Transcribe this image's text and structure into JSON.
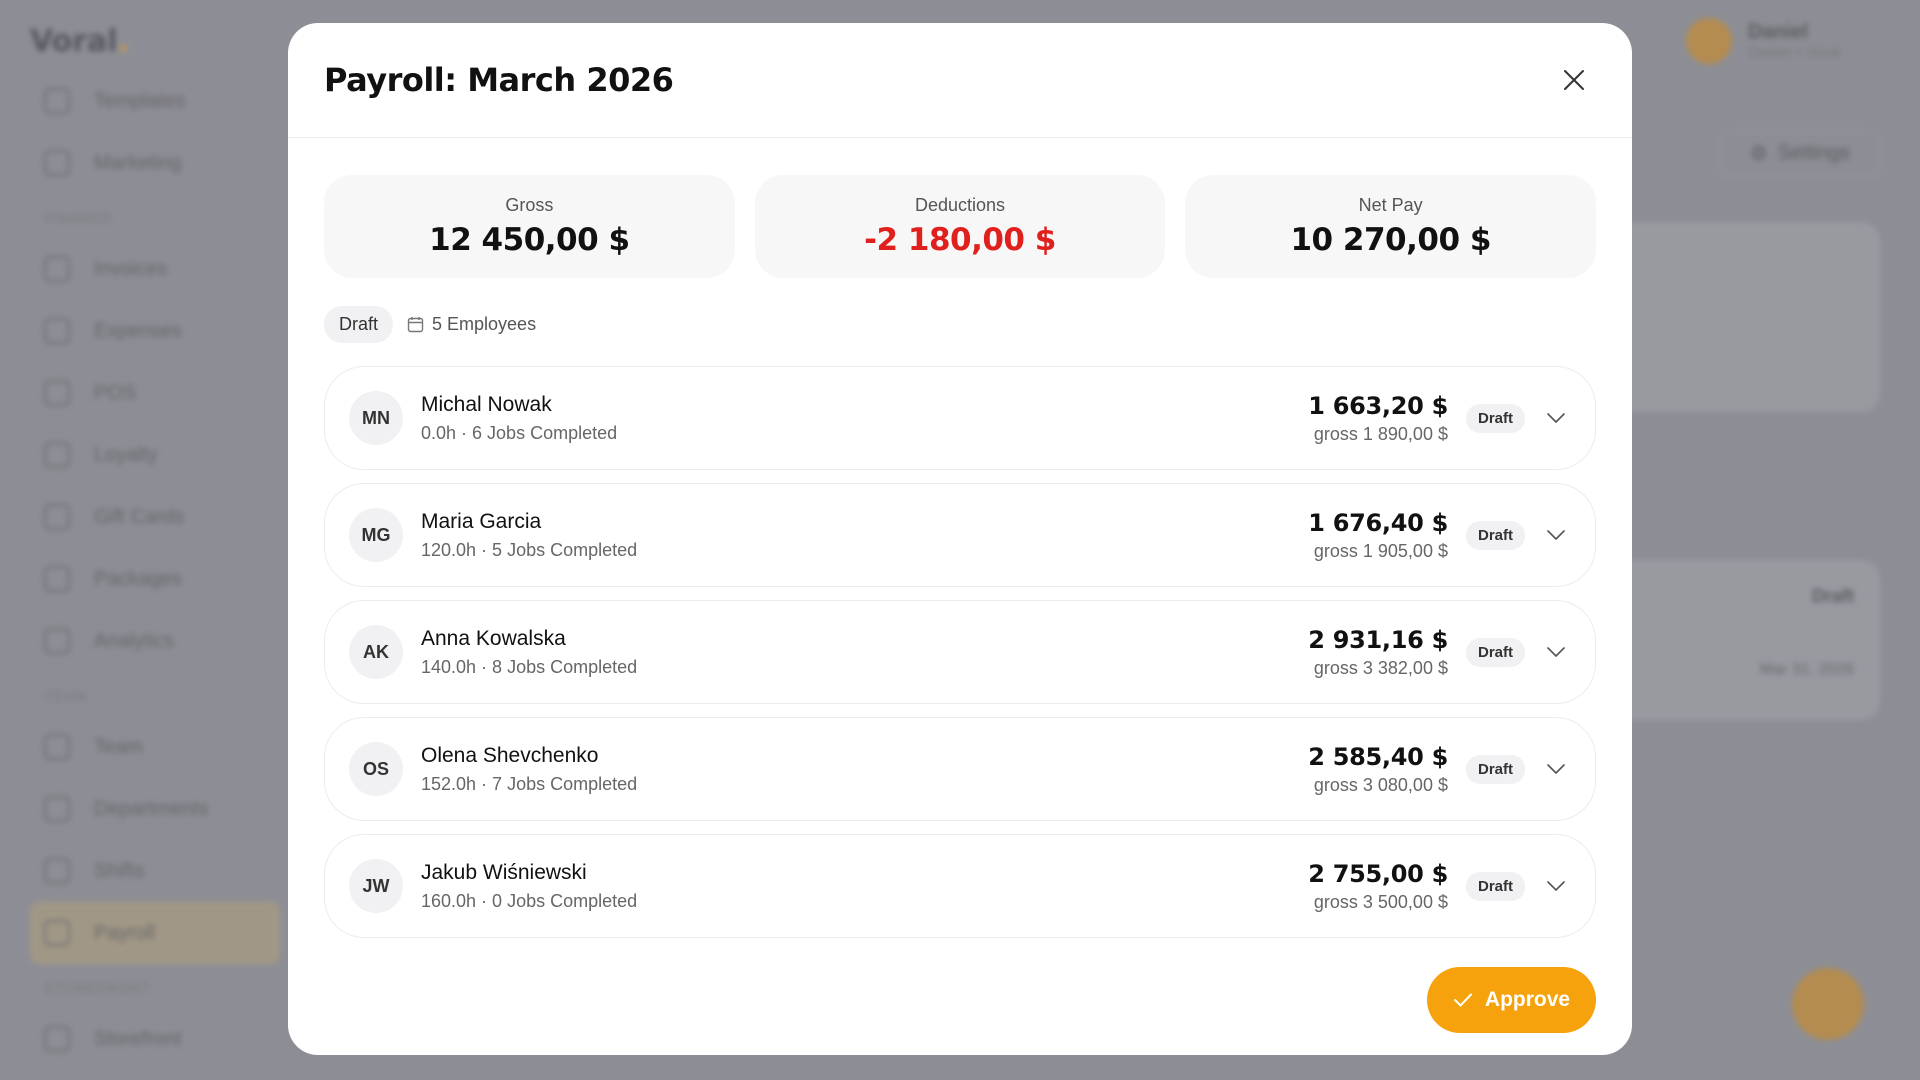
{
  "background": {
    "logo": "Voral",
    "nav": [
      {
        "label": "Templates",
        "icon": "template-icon"
      },
      {
        "label": "Marketing",
        "icon": "megaphone-icon"
      },
      {
        "section": "FINANCE"
      },
      {
        "label": "Invoices",
        "icon": "invoice-icon"
      },
      {
        "label": "Expenses",
        "icon": "receipt-icon"
      },
      {
        "label": "POS",
        "icon": "cart-icon"
      },
      {
        "label": "Loyalty",
        "icon": "heart-icon"
      },
      {
        "label": "Gift Cards",
        "icon": "gift-icon"
      },
      {
        "label": "Packages",
        "icon": "package-icon"
      },
      {
        "label": "Analytics",
        "icon": "chart-icon"
      },
      {
        "section": "TEAM"
      },
      {
        "label": "Team",
        "icon": "users-icon"
      },
      {
        "label": "Departments",
        "icon": "building-icon"
      },
      {
        "label": "Shifts",
        "icon": "clock-icon"
      },
      {
        "label": "Payroll",
        "icon": "wallet-icon",
        "active": true
      },
      {
        "section": "STOREFRONT"
      },
      {
        "label": "Storefront",
        "icon": "store-icon"
      }
    ],
    "user_name": "Daniel",
    "user_sub": "Owner • Voral",
    "settings_label": "Settings",
    "bg_badge": "Draft",
    "bg_date": "Mar 31, 2026"
  },
  "modal": {
    "title": "Payroll: March 2026",
    "summary": {
      "gross_label": "Gross",
      "gross_value": "12 450,00 $",
      "deductions_label": "Deductions",
      "deductions_value": "-2 180,00 $",
      "net_label": "Net Pay",
      "net_value": "10 270,00 $"
    },
    "status": "Draft",
    "employee_count": "5 Employees",
    "employees": [
      {
        "initials": "MN",
        "name": "Michal Nowak",
        "sub": "0.0h · 6 Jobs Completed",
        "net": "1 663,20 $",
        "gross": "gross 1 890,00 $",
        "status": "Draft"
      },
      {
        "initials": "MG",
        "name": "Maria Garcia",
        "sub": "120.0h · 5 Jobs Completed",
        "net": "1 676,40 $",
        "gross": "gross 1 905,00 $",
        "status": "Draft"
      },
      {
        "initials": "AK",
        "name": "Anna Kowalska",
        "sub": "140.0h · 8 Jobs Completed",
        "net": "2 931,16 $",
        "gross": "gross 3 382,00 $",
        "status": "Draft"
      },
      {
        "initials": "OS",
        "name": "Olena Shevchenko",
        "sub": "152.0h · 7 Jobs Completed",
        "net": "2 585,40 $",
        "gross": "gross 3 080,00 $",
        "status": "Draft"
      },
      {
        "initials": "JW",
        "name": "Jakub Wiśniewski",
        "sub": "160.0h · 0 Jobs Completed",
        "net": "2 755,00 $",
        "gross": "gross 3 500,00 $",
        "status": "Draft"
      }
    ],
    "approve_label": "Approve"
  },
  "colors": {
    "accent": "#f5a20d",
    "negative": "#e0201d"
  }
}
